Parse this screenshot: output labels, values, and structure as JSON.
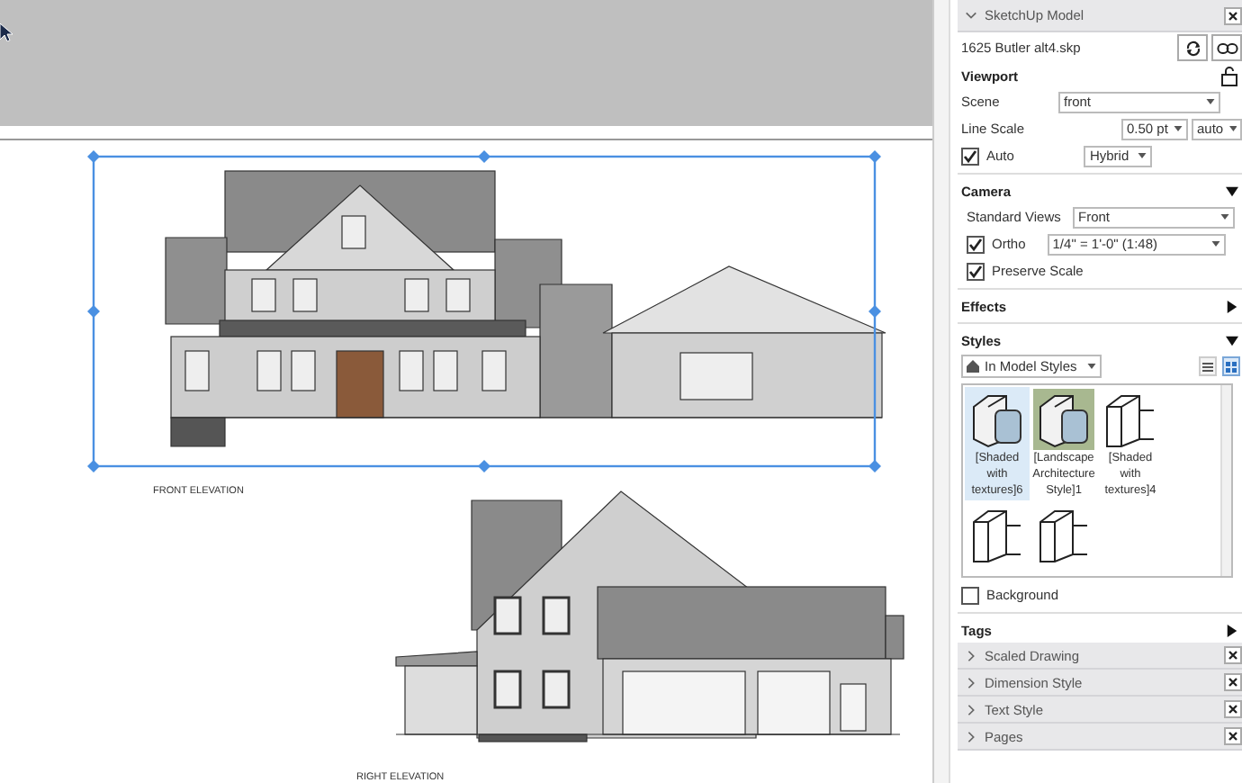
{
  "inspector": {
    "title": "SketchUp Model",
    "expanded": true,
    "file": "1625 Butler alt4.skp"
  },
  "viewport": {
    "title": "Viewport",
    "scene_label": "Scene",
    "scene": "front",
    "line_scale_label": "Line Scale",
    "line_scale": "0.50 pt",
    "line_scale_mode": "auto",
    "auto": {
      "label": "Auto",
      "checked": true
    },
    "render_mode": "Hybrid"
  },
  "camera": {
    "title": "Camera",
    "expanded": true,
    "standard_views_label": "Standard Views",
    "standard_view": "Front",
    "ortho": {
      "label": "Ortho",
      "checked": true
    },
    "scale": "1/4\" = 1'-0\" (1:48)",
    "preserve_scale": {
      "label": "Preserve Scale",
      "checked": true
    }
  },
  "effects": {
    "title": "Effects",
    "expanded": false
  },
  "styles": {
    "title": "Styles",
    "expanded": true,
    "collection": "In Model Styles",
    "view_modes": [
      {
        "kind": "list",
        "selected": false
      },
      {
        "kind": "grid",
        "selected": true
      }
    ],
    "items": [
      {
        "label": "[Shaded with textures]6",
        "selected": true,
        "kind": "shaded"
      },
      {
        "label": "[Landscape Architecture Style]1",
        "selected": false,
        "kind": "landscape"
      },
      {
        "label": "[Shaded with textures]4",
        "selected": false,
        "kind": "sketch"
      },
      {
        "selected": false,
        "kind": "sketch"
      },
      {
        "selected": false,
        "kind": "sketch"
      }
    ],
    "background": {
      "label": "Background",
      "checked": false
    }
  },
  "tags": {
    "title": "Tags",
    "expanded": false
  },
  "panels": [
    {
      "title": "Scaled Drawing",
      "expanded": false
    },
    {
      "title": "Dimension Style",
      "expanded": false
    },
    {
      "title": "Text Style",
      "expanded": false
    },
    {
      "title": "Pages",
      "expanded": false
    }
  ],
  "canvas": {
    "drawings": [
      {
        "kind": "front",
        "title": "FRONT ELEVATION",
        "selected": true
      },
      {
        "kind": "right",
        "title": "RIGHT ELEVATION",
        "selected": false
      }
    ]
  }
}
